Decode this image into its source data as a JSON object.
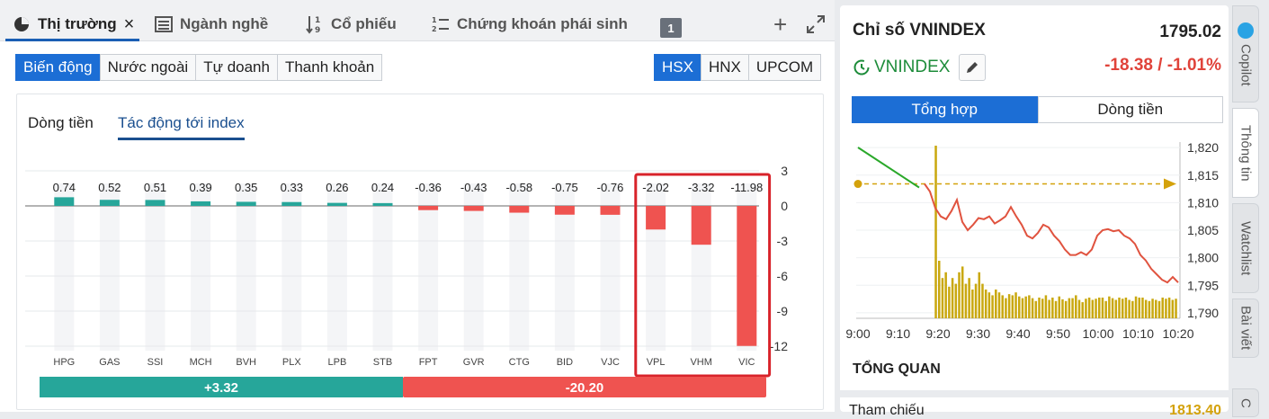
{
  "tabs": {
    "market": "Thị trường",
    "sector": "Ngành nghề",
    "stock": "Cổ phiếu",
    "derivative": "Chứng khoán phái sinh",
    "badge": "1"
  },
  "left_segments": [
    "Biến động",
    "Nước ngoài",
    "Tự doanh",
    "Thanh khoản"
  ],
  "exchange_segments": [
    "HSX",
    "HNX",
    "UPCOM"
  ],
  "subtabs": {
    "cash": "Dòng tiền",
    "impact": "Tác động tới index"
  },
  "chart_data": [
    {
      "type": "bar",
      "categories": [
        "HPG",
        "GAS",
        "SSI",
        "MCH",
        "BVH",
        "PLX",
        "LPB",
        "STB",
        "FPT",
        "GVR",
        "CTG",
        "BID",
        "VJC",
        "VPL",
        "VHM",
        "VIC"
      ],
      "values": [
        0.74,
        0.52,
        0.51,
        0.39,
        0.35,
        0.33,
        0.26,
        0.24,
        -0.36,
        -0.43,
        -0.58,
        -0.75,
        -0.76,
        -2.02,
        -3.32,
        -11.98
      ],
      "value_labels": [
        "0.74",
        "0.52",
        "0.51",
        "0.39",
        "0.35",
        "0.33",
        "0.26",
        "0.24",
        "-0.36",
        "-0.43",
        "-0.58",
        "-0.75",
        "-0.76",
        "-2.02",
        "-3.32",
        "-11.98"
      ],
      "yticks": [
        "3",
        "0",
        "-3",
        "-6",
        "-9",
        "-12"
      ],
      "ylim": [
        -12,
        3
      ],
      "highlighted": [
        "VPL",
        "VHM",
        "VIC"
      ],
      "totals": {
        "positive": "+3.32",
        "negative": "-20.20"
      },
      "colors": {
        "positive": "#26a69a",
        "negative": "#ef5350",
        "highlight_box": "#d8232a"
      }
    },
    {
      "type": "line",
      "x_ticks": [
        "9:00",
        "9:10",
        "9:20",
        "9:30",
        "9:40",
        "9:50",
        "10:00",
        "10:10",
        "10:20"
      ],
      "y_ticks": [
        "1,820",
        "1,815",
        "1,810",
        "1,805",
        "1,800",
        "1,795",
        "1,790"
      ],
      "ylim": [
        1789,
        1821
      ],
      "reference": 1813.4,
      "series": [
        {
          "values": [
            1813.4,
            1812.0,
            1809.0,
            1807.5,
            1807.0,
            1808.5,
            1810.5,
            1806.5,
            1805.0,
            1806.0,
            1807.2,
            1807.0,
            1807.5,
            1806.2,
            1806.8,
            1807.5,
            1809.2,
            1807.5,
            1806.0,
            1804.0,
            1803.5,
            1804.5,
            1806.0,
            1805.5,
            1804.0,
            1803.0,
            1801.5,
            1800.5,
            1800.5,
            1801.0,
            1800.5,
            1801.5,
            1804.0,
            1805.0,
            1805.2,
            1804.8,
            1805.0,
            1804.0,
            1803.5,
            1802.5,
            1800.5,
            1799.5,
            1798.0,
            1797.0,
            1796.0,
            1795.5,
            1796.5,
            1795.5
          ]
        }
      ],
      "volume": [
        0,
        0,
        0,
        0,
        0,
        0,
        0,
        0,
        0,
        0,
        0,
        0,
        0,
        0,
        0,
        0,
        0,
        0,
        0,
        0,
        0,
        0,
        0,
        30,
        10,
        7,
        8,
        5.5,
        7,
        6,
        8,
        9,
        6,
        7,
        5,
        6,
        8,
        6,
        5,
        4.5,
        4,
        5,
        4.5,
        4,
        3.5,
        4.2,
        4,
        4.5,
        3.8,
        3.5,
        3.8,
        4,
        3.5,
        3,
        3.6,
        3.4,
        4,
        3.2,
        3.6,
        3,
        3.8,
        3.3,
        3,
        3.5,
        3.5,
        4,
        3.2,
        2.8,
        3.4,
        3.6,
        3.2,
        3.4,
        3.6,
        3.6,
        3,
        3.8,
        3.5,
        3.2,
        3.6,
        3.4,
        3.6,
        3.2,
        3,
        3.8,
        3.6,
        3.6,
        3.2,
        3,
        3.4,
        3.2,
        3,
        3.6,
        3.4,
        3.6,
        3.2,
        3.4
      ],
      "colors": {
        "line": "#e0533f",
        "volume": "#c9a80f",
        "reference": "#d4a20c",
        "trend": "#2aa82a"
      }
    }
  ],
  "index": {
    "title": "Chỉ số VNINDEX",
    "value": "1795.02",
    "name": "VNINDEX",
    "change": "-18.38 / -1.01%",
    "segments": [
      "Tổng hợp",
      "Dòng tiền"
    ],
    "overview_title": "TỔNG QUAN",
    "reference_label": "Tham chiếu",
    "reference_value": "1813.40"
  },
  "rail": [
    "Copilot",
    "Thông tin",
    "Watchlist",
    "Bài viết",
    "C"
  ]
}
